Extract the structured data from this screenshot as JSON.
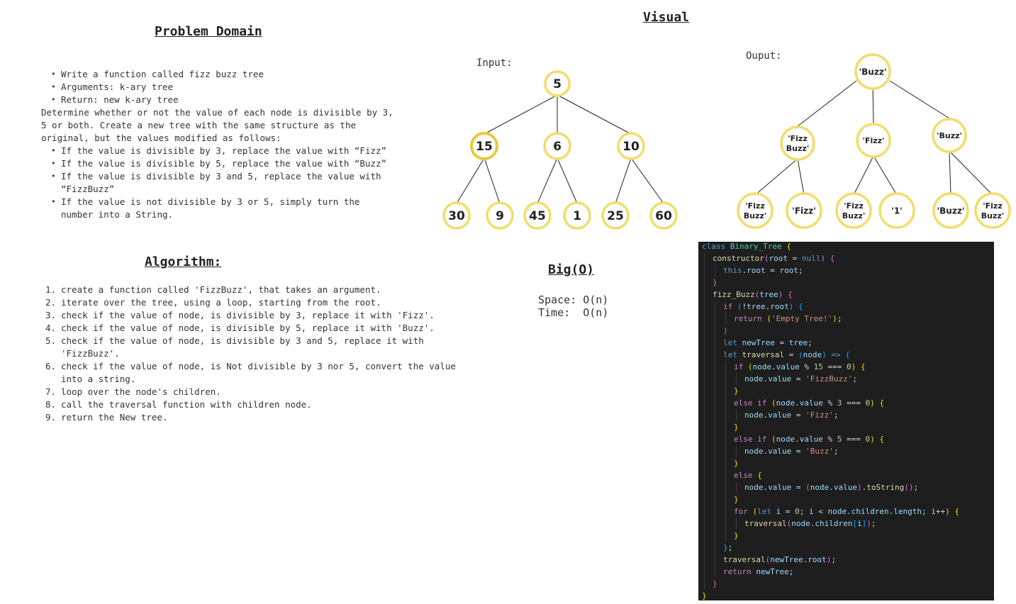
{
  "headings": {
    "problem_domain": "Problem Domain",
    "visual": "Visual",
    "algorithm": "Algorithm:",
    "big_o": "Big(O)"
  },
  "problem": {
    "bullets": [
      "Write a function called fizz buzz tree",
      "Arguments: k-ary tree",
      "Return: new k-ary tree"
    ],
    "description": [
      "Determine whether or not the value of each node is divisible by 3,",
      "5 or both. Create a new tree with the same structure as the",
      "original, but the values modified as follows:"
    ],
    "rules": [
      [
        "If the value is divisible by 3, replace the value with “Fizz”"
      ],
      [
        "If the value is divisible by 5, replace the value with “Buzz”"
      ],
      [
        "If the value is divisible by 3 and 5, replace the value with",
        "“FizzBuzz”"
      ],
      [
        "If the value is not divisible by 3 or 5, simply turn the",
        "number into a String."
      ]
    ]
  },
  "algorithm": {
    "steps": [
      [
        "create a function called 'FizzBuzz', that takes an argument."
      ],
      [
        "iterate over the tree, using a loop, starting from the root."
      ],
      [
        "check if the value of node, is divisible by 3, replace it with 'Fizz'."
      ],
      [
        "check if the value of node, is divisible by 5, replace it with 'Buzz'."
      ],
      [
        "check if the value of node, is divisible by 3 and 5, replace it with",
        "'FizzBuzz'."
      ],
      [
        "check if the value of node, is Not divisible by 3 nor 5, convert the value",
        "into a string."
      ],
      [
        "loop over the node's children."
      ],
      [
        "call the traversal function with children node."
      ],
      [
        "return the New tree."
      ]
    ]
  },
  "big_o": {
    "space_label": "Space:",
    "space_value": "O(n)",
    "time_label": "Time:",
    "time_value": "O(n)"
  },
  "visual": {
    "input_label": "Input:",
    "output_label": "Ouput:",
    "input_tree": {
      "root": "5",
      "children": [
        {
          "value": "15",
          "children": [
            "30",
            "9"
          ]
        },
        {
          "value": "6",
          "children": [
            "45",
            "1"
          ]
        },
        {
          "value": "10",
          "children": [
            "25",
            "60"
          ]
        }
      ]
    },
    "output_tree": {
      "root": [
        "'Buzz'"
      ],
      "children": [
        {
          "value": [
            "'Fizz",
            "Buzz'"
          ],
          "children": [
            [
              "'Fizz",
              "Buzz'"
            ],
            [
              "'Fizz'"
            ]
          ]
        },
        {
          "value": [
            "'Fizz'"
          ],
          "children": [
            [
              "'Fizz",
              "Buzz'"
            ],
            [
              "'1'"
            ]
          ]
        },
        {
          "value": [
            "'Buzz'"
          ],
          "children": [
            [
              "'Buzz'"
            ],
            [
              "'Fizz",
              "Buzz'"
            ]
          ]
        }
      ]
    }
  },
  "code_lines": [
    [
      [
        "k1",
        "class "
      ],
      [
        "cls",
        "Binary_Tree "
      ],
      [
        "p",
        "{"
      ]
    ],
    [
      [
        "fn",
        "constructor"
      ],
      [
        "pp",
        "("
      ],
      [
        "v",
        "root "
      ],
      [
        "d",
        "= "
      ],
      [
        "k1",
        "null"
      ],
      [
        "pp",
        ") "
      ],
      [
        "pp",
        "{"
      ]
    ],
    [
      [
        "k1",
        "this"
      ],
      [
        "d",
        "."
      ],
      [
        "v",
        "root "
      ],
      [
        "d",
        "= "
      ],
      [
        "v",
        "root"
      ],
      [
        "d",
        ";"
      ]
    ],
    [
      [
        "pp",
        "}"
      ]
    ],
    [
      [
        "fn",
        "fizz_Buzz"
      ],
      [
        "pp",
        "("
      ],
      [
        "v",
        "tree"
      ],
      [
        "pp",
        ") "
      ],
      [
        "pp",
        "{"
      ]
    ],
    [
      [
        "k2",
        "if "
      ],
      [
        "pb",
        "("
      ],
      [
        "d",
        "!"
      ],
      [
        "v",
        "tree"
      ],
      [
        "d",
        "."
      ],
      [
        "v",
        "root"
      ],
      [
        "pb",
        ") "
      ],
      [
        "pb",
        "{"
      ]
    ],
    [
      [
        "k2",
        "return "
      ],
      [
        "p",
        "("
      ],
      [
        "s",
        "'Empty Tree!'"
      ],
      [
        "p",
        ")"
      ],
      [
        "d",
        ";"
      ]
    ],
    [
      [
        "pb",
        "}"
      ]
    ],
    [
      [
        "k1",
        "let "
      ],
      [
        "v",
        "newTree "
      ],
      [
        "d",
        "= "
      ],
      [
        "v",
        "tree"
      ],
      [
        "d",
        ";"
      ]
    ],
    [
      [
        "k1",
        "let "
      ],
      [
        "fn",
        "traversal "
      ],
      [
        "d",
        "= "
      ],
      [
        "pb",
        "("
      ],
      [
        "v",
        "node"
      ],
      [
        "pb",
        ") "
      ],
      [
        "k1",
        "=> "
      ],
      [
        "pb",
        "{"
      ]
    ],
    [
      [
        "k2",
        "if "
      ],
      [
        "p",
        "("
      ],
      [
        "v",
        "node"
      ],
      [
        "d",
        "."
      ],
      [
        "v",
        "value "
      ],
      [
        "d",
        "% "
      ],
      [
        "n",
        "15 "
      ],
      [
        "d",
        "=== "
      ],
      [
        "n",
        "0"
      ],
      [
        "p",
        ") "
      ],
      [
        "p",
        "{"
      ]
    ],
    [
      [
        "v",
        "node"
      ],
      [
        "d",
        "."
      ],
      [
        "v",
        "value "
      ],
      [
        "d",
        "= "
      ],
      [
        "s",
        "'FizzBuzz'"
      ],
      [
        "d",
        ";"
      ]
    ],
    [
      [
        "p",
        "}"
      ]
    ],
    [
      [
        "k2",
        "else if "
      ],
      [
        "p",
        "("
      ],
      [
        "v",
        "node"
      ],
      [
        "d",
        "."
      ],
      [
        "v",
        "value "
      ],
      [
        "d",
        "% "
      ],
      [
        "n",
        "3 "
      ],
      [
        "d",
        "=== "
      ],
      [
        "n",
        "0"
      ],
      [
        "p",
        ") "
      ],
      [
        "p",
        "{"
      ]
    ],
    [
      [
        "v",
        "node"
      ],
      [
        "d",
        "."
      ],
      [
        "v",
        "value "
      ],
      [
        "d",
        "= "
      ],
      [
        "s",
        "'Fizz'"
      ],
      [
        "d",
        ";"
      ]
    ],
    [
      [
        "p",
        "}"
      ]
    ],
    [
      [
        "k2",
        "else if "
      ],
      [
        "p",
        "("
      ],
      [
        "v",
        "node"
      ],
      [
        "d",
        "."
      ],
      [
        "v",
        "value "
      ],
      [
        "d",
        "% "
      ],
      [
        "n",
        "5 "
      ],
      [
        "d",
        "=== "
      ],
      [
        "n",
        "0"
      ],
      [
        "p",
        ") "
      ],
      [
        "p",
        "{"
      ]
    ],
    [
      [
        "v",
        "node"
      ],
      [
        "d",
        "."
      ],
      [
        "v",
        "value "
      ],
      [
        "d",
        "= "
      ],
      [
        "s",
        "'Buzz'"
      ],
      [
        "d",
        ";"
      ]
    ],
    [
      [
        "p",
        "}"
      ]
    ],
    [
      [
        "k2",
        "else "
      ],
      [
        "p",
        "{"
      ]
    ],
    [
      [
        "v",
        "node"
      ],
      [
        "d",
        "."
      ],
      [
        "v",
        "value "
      ],
      [
        "d",
        "= "
      ],
      [
        "pp",
        "("
      ],
      [
        "v",
        "node"
      ],
      [
        "d",
        "."
      ],
      [
        "v",
        "value"
      ],
      [
        "pp",
        ")"
      ],
      [
        "d",
        "."
      ],
      [
        "fn",
        "toString"
      ],
      [
        "pp",
        "()"
      ],
      [
        "d",
        ";"
      ]
    ],
    [
      [
        "p",
        "}"
      ]
    ],
    [
      [
        "k2",
        "for "
      ],
      [
        "p",
        "("
      ],
      [
        "k1",
        "let "
      ],
      [
        "v",
        "i "
      ],
      [
        "d",
        "= "
      ],
      [
        "n",
        "0"
      ],
      [
        "d",
        "; "
      ],
      [
        "v",
        "i "
      ],
      [
        "d",
        "< "
      ],
      [
        "v",
        "node"
      ],
      [
        "d",
        "."
      ],
      [
        "v",
        "children"
      ],
      [
        "d",
        "."
      ],
      [
        "v",
        "length"
      ],
      [
        "d",
        "; "
      ],
      [
        "v",
        "i"
      ],
      [
        "d",
        "++"
      ],
      [
        "p",
        ") "
      ],
      [
        "p",
        "{"
      ]
    ],
    [
      [
        "fn",
        "traversal"
      ],
      [
        "pp",
        "("
      ],
      [
        "v",
        "node"
      ],
      [
        "d",
        "."
      ],
      [
        "v",
        "children"
      ],
      [
        "pb",
        "["
      ],
      [
        "v",
        "i"
      ],
      [
        "pb",
        "]"
      ],
      [
        "pp",
        ")"
      ],
      [
        "d",
        ";"
      ]
    ],
    [
      [
        "p",
        "}"
      ]
    ],
    [
      [
        "pb",
        "}"
      ],
      [
        "d",
        ";"
      ]
    ],
    [
      [
        "fn",
        "traversal"
      ],
      [
        "pp",
        "("
      ],
      [
        "v",
        "newTree"
      ],
      [
        "d",
        "."
      ],
      [
        "v",
        "root"
      ],
      [
        "pp",
        ")"
      ],
      [
        "d",
        ";"
      ]
    ],
    [
      [
        "k2",
        "return "
      ],
      [
        "v",
        "newTree"
      ],
      [
        "d",
        ";"
      ]
    ],
    [
      [
        "pp",
        "}"
      ]
    ],
    [
      [
        "p",
        "}"
      ]
    ]
  ],
  "colors": {
    "node_stroke": "#f1dd6a",
    "node_stroke_highlight": "#e8c93a",
    "edge": "#222222",
    "code_background": "#1e1e1e"
  }
}
